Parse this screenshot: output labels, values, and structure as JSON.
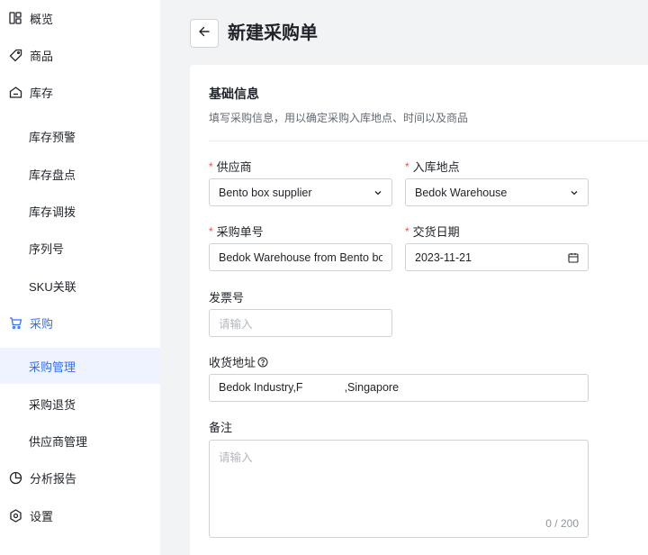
{
  "sidebar": {
    "items": [
      {
        "label": "概览",
        "icon": "dashboard-icon"
      },
      {
        "label": "商品",
        "icon": "tag-icon"
      },
      {
        "label": "库存",
        "icon": "warehouse-icon"
      },
      {
        "label": "库存预警"
      },
      {
        "label": "库存盘点"
      },
      {
        "label": "库存调拨"
      },
      {
        "label": "序列号"
      },
      {
        "label": "SKU关联"
      },
      {
        "label": "采购",
        "icon": "cart-icon"
      },
      {
        "label": "采购管理",
        "active": true
      },
      {
        "label": "采购退货"
      },
      {
        "label": "供应商管理"
      },
      {
        "label": "分析报告",
        "icon": "pie-chart-icon"
      },
      {
        "label": "设置",
        "icon": "settings-icon"
      }
    ]
  },
  "header": {
    "title": "新建采购单"
  },
  "section": {
    "title": "基础信息",
    "description": "填写采购信息，用以确定采购入库地点、时间以及商品"
  },
  "form": {
    "supplier": {
      "label": "供应商",
      "value": "Bento box supplier"
    },
    "location": {
      "label": "入库地点",
      "value": "Bedok Warehouse"
    },
    "po_number": {
      "label": "采购单号",
      "value": "Bedok Warehouse from Bento bo"
    },
    "delivery_date": {
      "label": "交货日期",
      "value": "2023-11-21"
    },
    "invoice": {
      "label": "发票号",
      "placeholder": "请输入"
    },
    "address": {
      "label": "收货地址",
      "value_start": "Bedok Industry,F",
      "value_end": ",Singapore"
    },
    "remark": {
      "label": "备注",
      "placeholder": "请输入",
      "counter": "0 / 200"
    }
  },
  "colors": {
    "accent": "#3370ff",
    "required": "#f54a45",
    "active_bg": "#eef3ff"
  }
}
